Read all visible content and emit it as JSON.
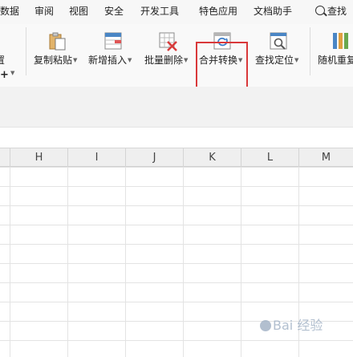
{
  "tabs": [
    "数据",
    "审阅",
    "视图",
    "安全",
    "开发工具",
    "特色应用",
    "文档助手"
  ],
  "search_label": "查找",
  "ribbon": {
    "left_stub_char": "置",
    "left_plus": "+",
    "buttons": [
      {
        "label": "复制粘贴"
      },
      {
        "label": "新增插入"
      },
      {
        "label": "批量删除"
      },
      {
        "label": "合并转换"
      },
      {
        "label": "查找定位"
      },
      {
        "label": "随机重复"
      }
    ]
  },
  "columns": [
    "H",
    "I",
    "J",
    "K",
    "L",
    "M"
  ],
  "watermark": "Bai 经验",
  "colors": {
    "highlight": "#d9383a",
    "tab_bg": "#f7f7f7",
    "ribbon_bg": "#f9f9f9"
  }
}
